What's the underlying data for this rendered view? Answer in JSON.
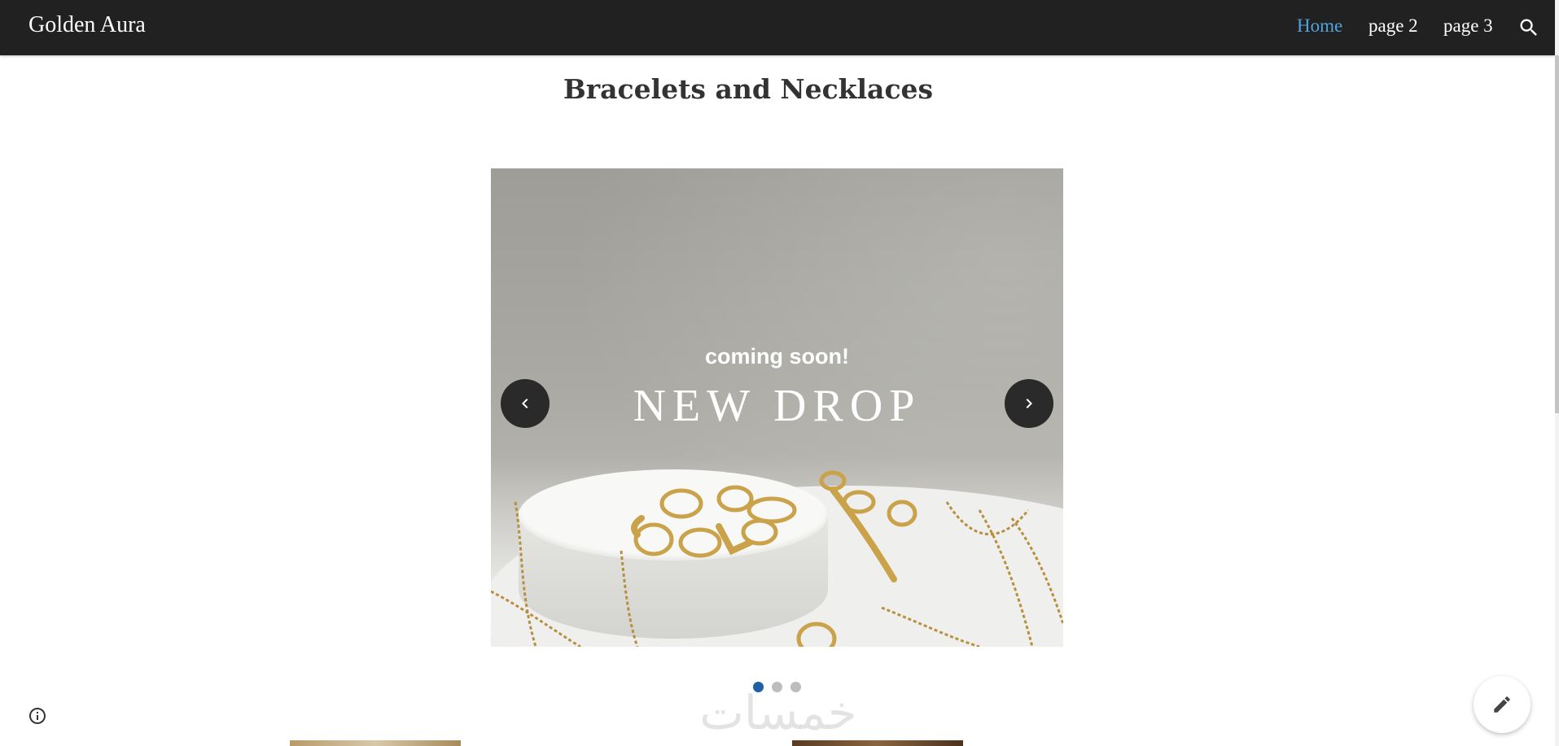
{
  "header": {
    "site_title": "Golden Aura",
    "nav": [
      {
        "label": "Home",
        "active": true
      },
      {
        "label": "page 2",
        "active": false
      },
      {
        "label": "page 3",
        "active": false
      }
    ],
    "search_icon": "search-icon",
    "active_color": "#4fa3e0",
    "background": "#212121"
  },
  "main": {
    "page_title": "Bracelets and Necklaces",
    "carousel": {
      "slide_text_top": "coming soon!",
      "slide_text_main": "NEW DROP",
      "prev_icon": "chevron-left-icon",
      "next_icon": "chevron-right-icon",
      "slide_count": 3,
      "active_slide": 1
    }
  },
  "overlay": {
    "watermark_text": "خمسات",
    "info_icon": "info-icon",
    "edit_icon": "pencil-icon"
  }
}
